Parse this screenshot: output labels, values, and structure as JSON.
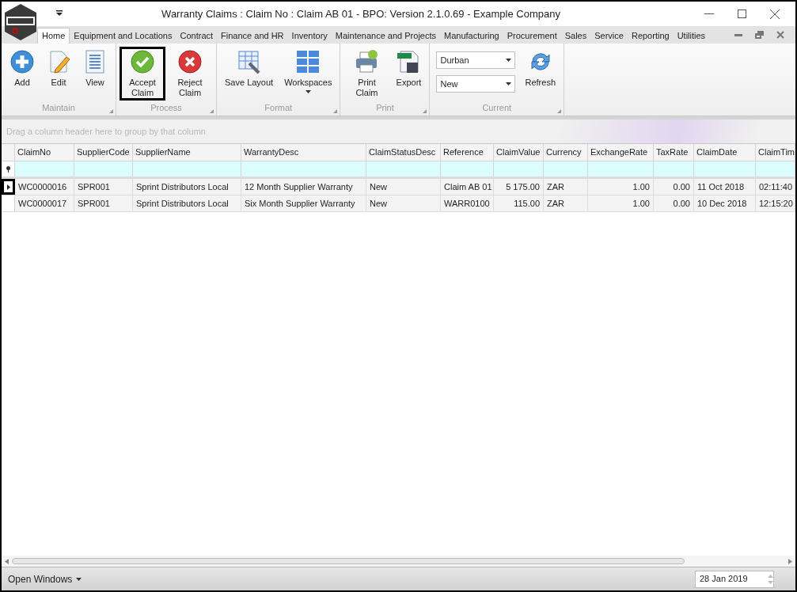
{
  "window": {
    "title": "Warranty Claims : Claim No : Claim AB 01 - BPO: Version 2.1.0.69 - Example Company"
  },
  "tabs": [
    {
      "label": "Home",
      "selected": true
    },
    {
      "label": "Equipment and Locations",
      "selected": false
    },
    {
      "label": "Contract",
      "selected": false
    },
    {
      "label": "Finance and HR",
      "selected": false
    },
    {
      "label": "Inventory",
      "selected": false
    },
    {
      "label": "Maintenance and Projects",
      "selected": false
    },
    {
      "label": "Manufacturing",
      "selected": false
    },
    {
      "label": "Procurement",
      "selected": false
    },
    {
      "label": "Sales",
      "selected": false
    },
    {
      "label": "Service",
      "selected": false
    },
    {
      "label": "Reporting",
      "selected": false
    },
    {
      "label": "Utilities",
      "selected": false
    }
  ],
  "ribbon_groups": [
    {
      "label": "Maintain",
      "items": [
        {
          "kind": "add",
          "label": "Add",
          "highlighted": false
        },
        {
          "kind": "edit",
          "label": "Edit",
          "highlighted": false
        },
        {
          "kind": "view",
          "label": "View",
          "highlighted": false
        }
      ]
    },
    {
      "label": "Process",
      "items": [
        {
          "kind": "accept",
          "label": "Accept Claim",
          "highlighted": true
        },
        {
          "kind": "reject",
          "label": "Reject Claim",
          "highlighted": false
        }
      ]
    },
    {
      "label": "Format",
      "items": [
        {
          "kind": "layout",
          "label": "Save Layout",
          "highlighted": false
        },
        {
          "kind": "workspaces",
          "label": "Workspaces",
          "highlighted": false
        }
      ]
    },
    {
      "label": "Print",
      "items": [
        {
          "kind": "print",
          "label": "Print Claim",
          "highlighted": false
        },
        {
          "kind": "export",
          "label": "Export",
          "highlighted": false
        }
      ]
    },
    {
      "label": "Current",
      "dropdowns": [
        {
          "value": "Durban"
        },
        {
          "value": "New"
        }
      ],
      "items": [
        {
          "kind": "refresh",
          "label": "Refresh",
          "highlighted": false
        }
      ]
    }
  ],
  "group_panel": {
    "placeholder": "Drag a column header here to group by that column"
  },
  "table": {
    "columns": [
      "ClaimNo",
      "SupplierCode",
      "SupplierName",
      "WarrantyDesc",
      "ClaimStatusDesc",
      "Reference",
      "ClaimValue",
      "Currency",
      "ExchangeRate",
      "TaxRate",
      "ClaimDate",
      "ClaimTim"
    ],
    "rows": [
      {
        "selected": true,
        "cells": [
          "WC0000016",
          "SPR001",
          "Sprint Distributors Local",
          "12 Month Supplier Warranty",
          "New",
          "Claim AB 01",
          "5 175.00",
          "ZAR",
          "1.00",
          "0.00",
          "11 Oct 2018",
          "02:11:40"
        ]
      },
      {
        "selected": false,
        "cells": [
          "WC0000017",
          "SPR001",
          "Sprint Distributors Local",
          "Six Month Supplier Warranty",
          "New",
          "WARR0100",
          "115.00",
          "ZAR",
          "1.00",
          "0.00",
          "10 Dec 2018",
          "12:15:20"
        ]
      }
    ]
  },
  "status_bar": {
    "open_windows": "Open Windows",
    "date": "28 Jan 2019"
  }
}
